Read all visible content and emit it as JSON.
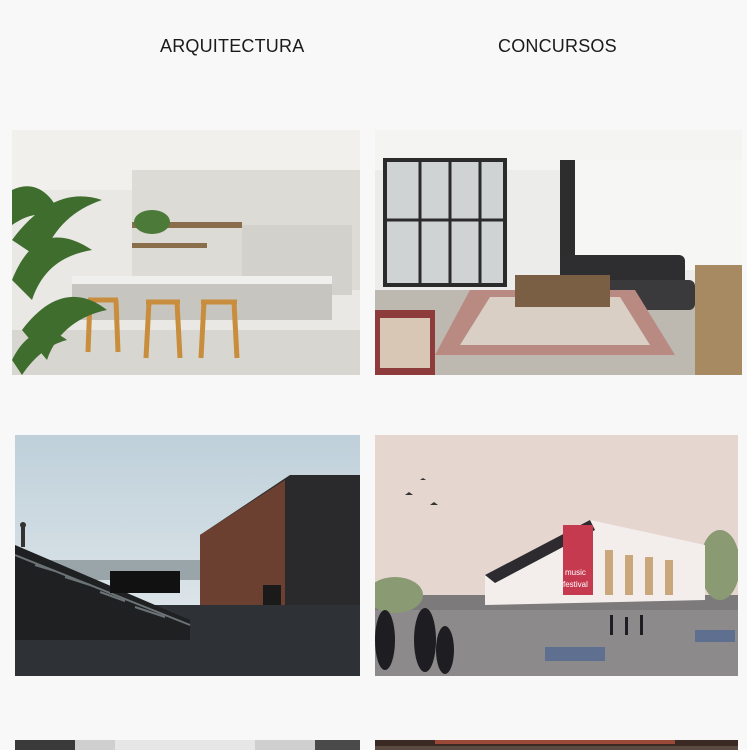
{
  "nav": {
    "tabs": [
      {
        "label": "ARQUITECTURA"
      },
      {
        "label": "CONCURSOS"
      }
    ]
  },
  "gallery": {
    "colors": {
      "background": "#f8f8f8",
      "text": "#1a1a1a"
    },
    "billboard_text": [
      "music",
      "festival"
    ]
  }
}
